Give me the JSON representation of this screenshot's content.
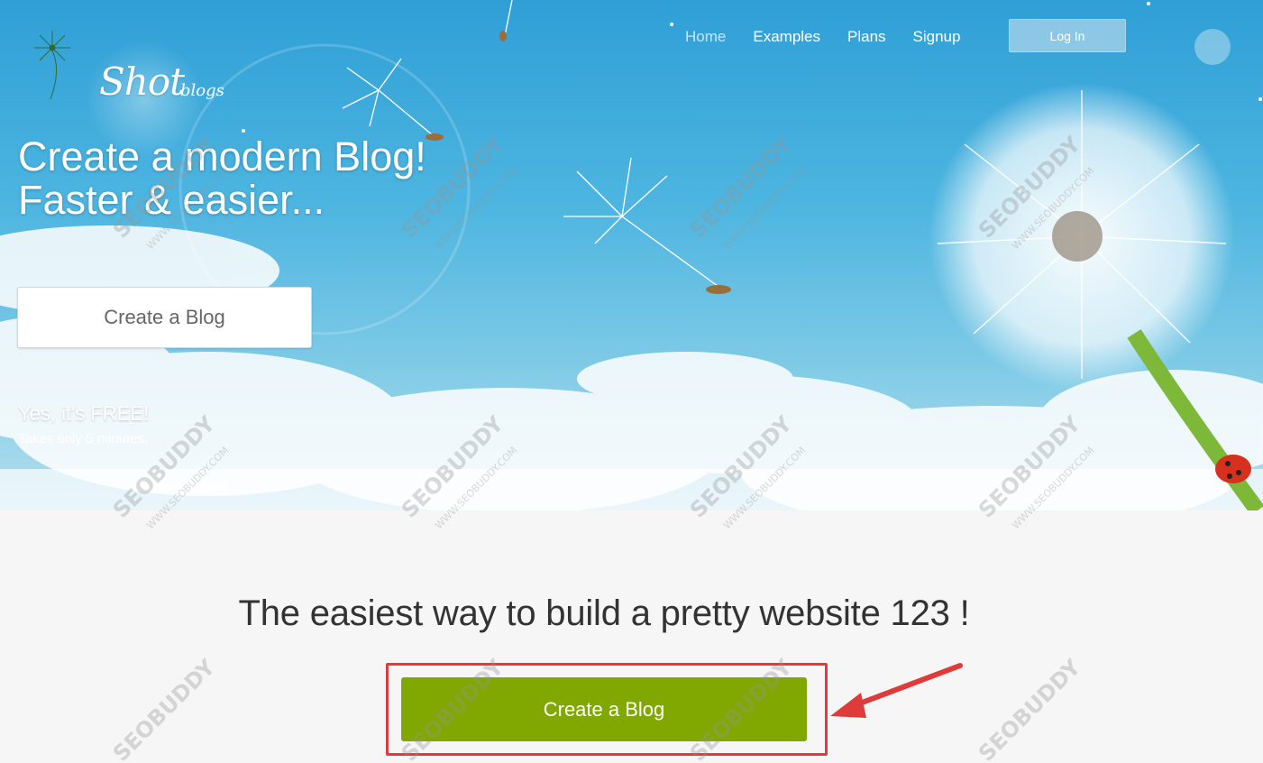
{
  "brand": {
    "name": "Shot",
    "suffix": "blogs"
  },
  "nav": {
    "items": [
      {
        "label": "Home",
        "active": true
      },
      {
        "label": "Examples",
        "active": false
      },
      {
        "label": "Plans",
        "active": false
      },
      {
        "label": "Signup",
        "active": false
      }
    ],
    "login_label": "Log In"
  },
  "hero": {
    "title_line1": "Create a modern Blog!",
    "title_line2": "Faster & easier...",
    "cta_label": "Create a Blog",
    "free_text": "Yes, it's FREE!",
    "minutes_text": "Takes only 5 minutes."
  },
  "lower": {
    "tagline": "The easiest way to build a pretty website 123 !",
    "cta_label": "Create a Blog"
  },
  "watermark": {
    "text": "SEOBUDDY",
    "sub": "WWW.SEOBUDDY.COM"
  },
  "colors": {
    "accent_green": "#80a800",
    "annotation_red": "#e03b3b",
    "sky_blue": "#2f9fd6"
  }
}
